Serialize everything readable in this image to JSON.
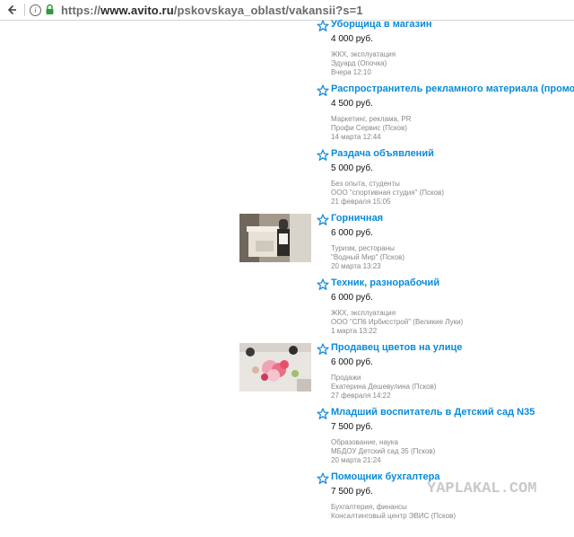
{
  "browser": {
    "url_scheme": "https://",
    "url_host": "www.avito.ru",
    "url_path": "/pskovskaya_oblast/vakansii?s=1"
  },
  "listings": [
    {
      "title": "Уборщица в магазин",
      "price": "4 000 руб.",
      "category": "ЖКХ, эксплуатация",
      "company": "Эдуард (Опочка)",
      "date": "Вчера 12:10"
    },
    {
      "title": "Распространитель рекламного материала (промоутер)",
      "price": "4 500 руб.",
      "category": "Маркетинг, реклама, PR",
      "company": "Профи Сервис (Псков)",
      "date": "14 марта 12:44"
    },
    {
      "title": "Раздача объявлений",
      "price": "5 000 руб.",
      "category": "Без опыта, студенты",
      "company": "ООО \"спортивная студия\" (Псков)",
      "date": "21 февраля 15:05"
    },
    {
      "title": "Горничная",
      "price": "6 000 руб.",
      "category": "Туризм, рестораны",
      "company": "\"Водный Мир\" (Псков)",
      "date": "20 марта 13:23"
    },
    {
      "title": "Техник, разнорабочий",
      "price": "6 000 руб.",
      "category": "ЖКХ, эксплуатация",
      "company": "ООО \"СП6 Ирбисстрой\" (Великие Луки)",
      "date": "1 марта 13:22"
    },
    {
      "title": "Продавец цветов на улице",
      "price": "6 000 руб.",
      "category": "Продажи",
      "company": "Екатерина Дешевулина (Псков)",
      "date": "27 февраля 14:22"
    },
    {
      "title": "Младший воспитатель в Детский сад N35",
      "price": "7 500 руб.",
      "category": "Образование, наука",
      "company": "МБДОУ Детский сад 35 (Псков)",
      "date": "20 марта 21:24"
    },
    {
      "title": "Помощник бухгалтера",
      "price": "7 500 руб.",
      "category": "Бухгалтерия, финансы",
      "company": "Консалтинговый центр ЭВИС (Псков)",
      "date": ""
    }
  ],
  "watermark": "YAPLAKAL.COM",
  "colors": {
    "link": "#0a8bd8",
    "star": "#1d8fd6"
  }
}
